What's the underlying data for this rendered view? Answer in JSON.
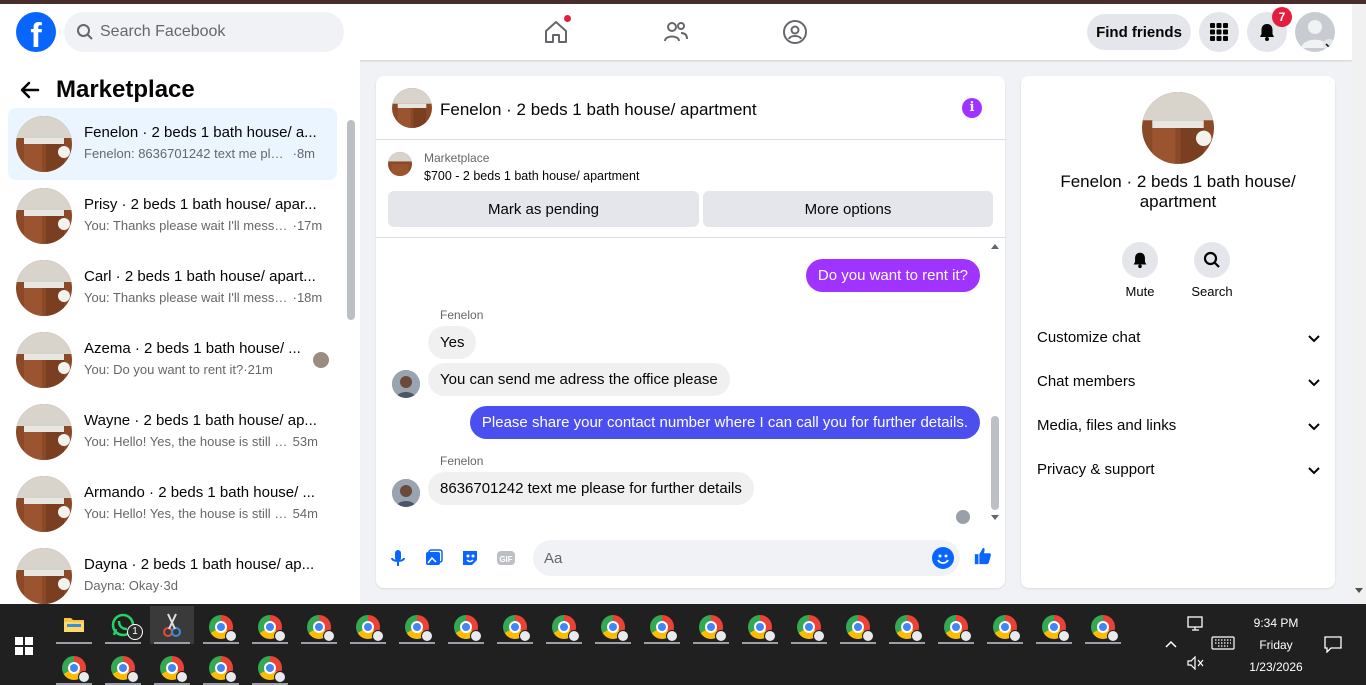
{
  "header": {
    "search_placeholder": "Search Facebook",
    "find_friends": "Find friends",
    "notifications_count": "7",
    "logo_letter": "f"
  },
  "sidebar": {
    "title": "Marketplace",
    "conversations": [
      {
        "name": "Fenelon · 2 beds 1 bath house/ a...",
        "snippet": "Fenelon: 8636701242 text me plea...",
        "time": "·8m"
      },
      {
        "name": "Prisy · 2 beds 1 bath house/ apar...",
        "snippet": "You: Thanks please wait I'll messa...",
        "time": "·17m"
      },
      {
        "name": "Carl · 2 beds 1 bath house/ apart...",
        "snippet": "You: Thanks please wait I'll messa...",
        "time": "·18m"
      },
      {
        "name": "Azema · 2 beds 1 bath house/ ...",
        "snippet": "You: Do you want to rent it?",
        "time": "·21m"
      },
      {
        "name": "Wayne · 2 beds 1 bath house/ ap...",
        "snippet": "You: Hello! Yes, the house is still a...",
        "time": "53m"
      },
      {
        "name": "Armando · 2 beds 1 bath house/ ...",
        "snippet": "You: Hello! Yes, the house is still a...",
        "time": "54m"
      },
      {
        "name": "Dayna · 2 beds 1 bath house/ ap...",
        "snippet": "Dayna: Okay",
        "time": "·3d"
      }
    ]
  },
  "chat": {
    "title": "Fenelon · 2 beds 1 bath house/ apartment",
    "marketplace_label": "Marketplace",
    "listing": "$700 - 2 beds 1 bath house/ apartment",
    "mark_pending": "Mark as pending",
    "more_options": "More options",
    "messages": {
      "m1": "Do you want to rent it?",
      "sender1": "Fenelon",
      "m2": "Yes",
      "m3": "You can send me adress the office please",
      "m4": "Please share your contact number where I can call you for further details.",
      "sender2": "Fenelon",
      "m5": "8636701242 text me please for further details"
    },
    "composer_placeholder": "Aa"
  },
  "details": {
    "title": "Fenelon · 2 beds 1 bath house/ apartment",
    "mute": "Mute",
    "search": "Search",
    "rows": [
      "Customize chat",
      "Chat members",
      "Media, files and links",
      "Privacy & support"
    ]
  },
  "taskbar": {
    "time": "9:34 PM",
    "day": "Friday",
    "date": "1/23/2026",
    "whatsapp_badge": "1"
  },
  "colors": {
    "brand": "#0866ff",
    "outgoing_purple": "#a033ff",
    "outgoing_blue": "#4b4ff0",
    "notification": "#e41e3f"
  }
}
